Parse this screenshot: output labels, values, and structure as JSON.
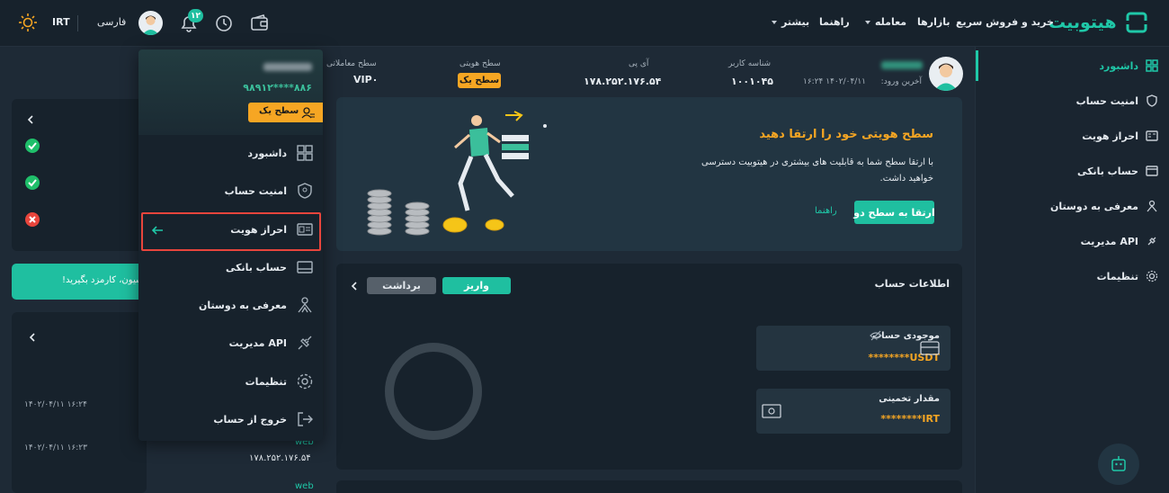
{
  "topbar": {
    "logo_text": "هیتوبیت",
    "nav": {
      "quick_buy": "خرید و فروش سریع",
      "markets": "بازارها",
      "trade": "معامله",
      "guide": "راهنما",
      "more": "بیشتر"
    },
    "notifications_count": "۱۲",
    "language": "فارسی",
    "currency": "IRT"
  },
  "sidebar": {
    "items": [
      {
        "label": "داشبورد",
        "icon": "dashboard-icon",
        "active": true
      },
      {
        "label": "امنیت حساب",
        "icon": "shield-icon"
      },
      {
        "label": "احراز هویت",
        "icon": "id-card-icon"
      },
      {
        "label": "حساب بانکی",
        "icon": "bank-card-icon"
      },
      {
        "label": "معرفی به دوستان",
        "icon": "referral-icon"
      },
      {
        "label": "مدیریت API",
        "icon": "api-plug-icon"
      },
      {
        "label": "تنظیمات",
        "icon": "gear-icon"
      }
    ]
  },
  "user_info": {
    "last_login_label": "آخرین ورود:",
    "last_login": "۱۴۰۲/۰۴/۱۱ ۱۶:۲۴",
    "user_id_label": "شناسه کاربر",
    "user_id": "۱۰۰۱۰۴۵",
    "ip_label": "آی پی",
    "ip": "۱۷۸.۲۵۲.۱۷۶.۵۴",
    "identity_level_label": "سطح هویتی",
    "identity_level": "سطح یک",
    "trade_level_label": "سطح معاملاتی",
    "trade_level": "VIP۰"
  },
  "banner": {
    "title": "سطح هویتی خود را ارتقا دهید",
    "text": "با ارتقا سطح شما به قابلیت های بیشتری در هیتوبیت دسترسی خواهید داشت.",
    "upgrade_button": "ارتقا به سطح دو",
    "guide_link": "راهنما"
  },
  "account": {
    "title": "اطلاعات حساب",
    "deposit_button": "واریز",
    "withdraw_button": "برداشت",
    "balance_label": "موجودی حساب",
    "balance_value": "********USDT",
    "estimate_label": "مقدار تخمینی",
    "estimate_value": "********IRT"
  },
  "dropdown": {
    "phone": "۹۸۹۱۲****۸۸۶",
    "level_badge": "سطح یک",
    "items": [
      {
        "label": "داشبورد",
        "icon": "dashboard-icon"
      },
      {
        "label": "امنیت حساب",
        "icon": "shield-icon"
      },
      {
        "label": "احراز هویت",
        "icon": "id-card-icon"
      },
      {
        "label": "حساب بانکی",
        "icon": "bank-card-icon"
      },
      {
        "label": "معرفی به دوستان",
        "icon": "referral-icon"
      },
      {
        "label": "مدیریت API",
        "icon": "api-plug-icon"
      },
      {
        "label": "تنظیمات",
        "icon": "gear-icon"
      },
      {
        "label": "خروج از حساب",
        "icon": "logout-icon"
      }
    ]
  },
  "left": {
    "promo_text": "سیون، کارمزد بگیرید!",
    "logins": [
      {
        "date": "۱۴۰۲/۰۴/۱۱ ۱۶:۲۴"
      },
      {
        "date": "۱۴۰۲/۰۴/۱۱ ۱۶:۲۳",
        "device": "web",
        "ip": "۱۷۸.۲۵۲.۱۷۶.۵۴"
      },
      {
        "device": "web"
      }
    ]
  },
  "colors": {
    "accent": "#1fc8a8",
    "warning": "#f6a623",
    "danger": "#e8453c",
    "background": "#1e2a36"
  }
}
